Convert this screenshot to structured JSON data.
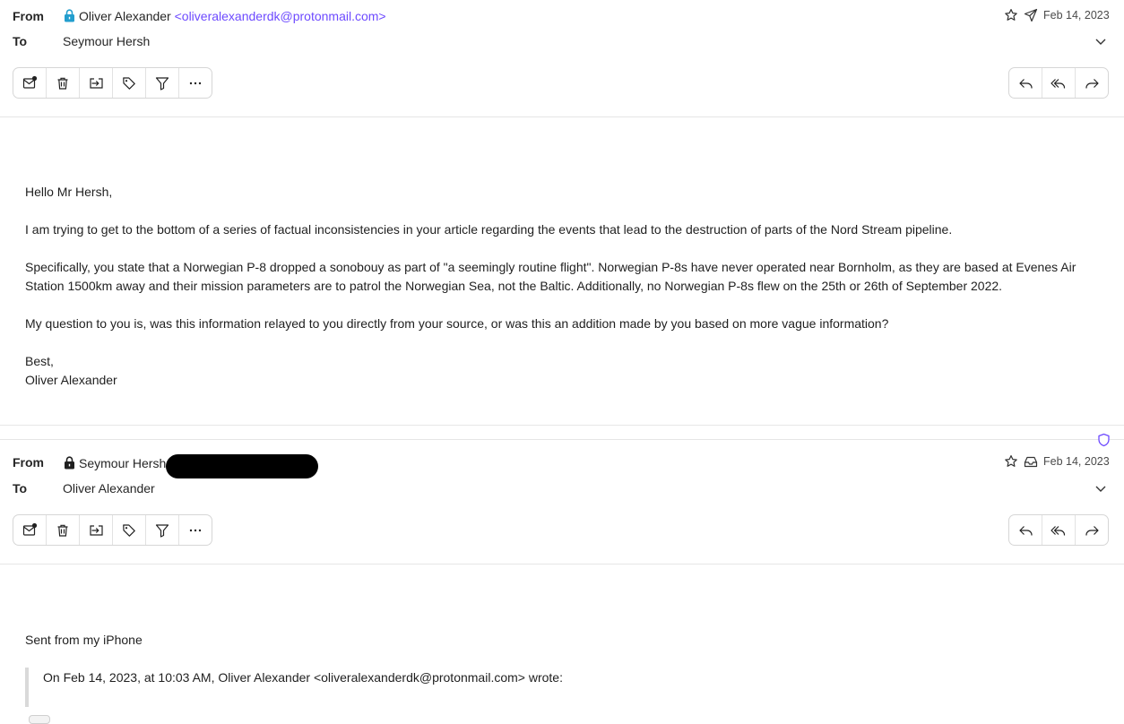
{
  "message1": {
    "from_label": "From",
    "to_label": "To",
    "sender_name": "Oliver Alexander",
    "sender_email": "<oliveralexanderdk@protonmail.com>",
    "recipient": "Seymour Hersh",
    "date": "Feb 14, 2023",
    "body": {
      "greeting": "Hello Mr Hersh,",
      "p1": "I am trying to get to the bottom of a series of factual inconsistencies in your article regarding the events that lead to the destruction of parts of the Nord Stream pipeline.",
      "p2": "Specifically, you state that a Norwegian P-8 dropped a sonobouy as part of \"a seemingly routine flight\". Norwegian P-8s have never operated near Bornholm, as they are based at Evenes Air Station 1500km away and their mission parameters are to patrol the Norwegian Sea, not the Baltic. Additionally, no Norwegian P-8s flew on the 25th or 26th of September 2022.",
      "p3": "My question to you is, was this information relayed to you directly from your source, or was this an addition made by you based on more vague information?",
      "signoff": "Best,",
      "signature": "Oliver Alexander"
    }
  },
  "message2": {
    "from_label": "From",
    "to_label": "To",
    "sender_name": "Seymour Hersh",
    "recipient": "Oliver Alexander",
    "date": "Feb 14, 2023",
    "body": {
      "line1": "Sent from my iPhone",
      "quote": "On Feb 14, 2023, at 10:03 AM, Oliver Alexander <oliveralexanderdk@protonmail.com> wrote:"
    }
  },
  "icons": {
    "toolbar_left": [
      "mark-unread-icon",
      "trash-icon",
      "move-to-icon",
      "label-icon",
      "filter-icon",
      "more-icon"
    ],
    "toolbar_right": [
      "reply-icon",
      "reply-all-icon",
      "forward-icon"
    ],
    "lock_color_message1": "#239ece",
    "lock_color_message2": "#1f1f1f",
    "accent": "#6d4aff"
  }
}
